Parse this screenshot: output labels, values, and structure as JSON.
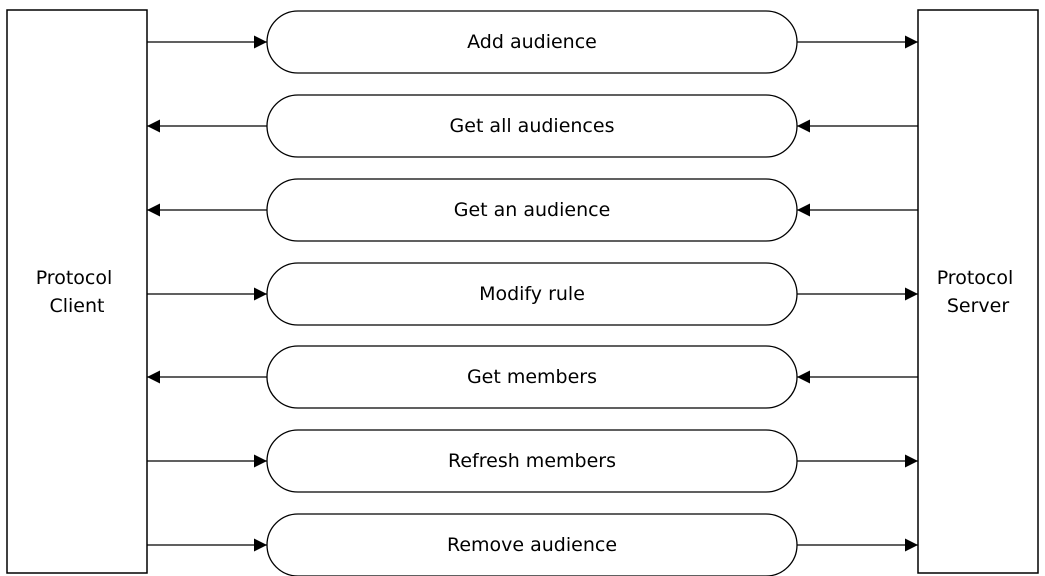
{
  "client": {
    "line1": "Protocol",
    "line2": "Client"
  },
  "server": {
    "line1": "Protocol",
    "line2": "Server"
  },
  "operations": [
    {
      "label": "Add audience",
      "direction": "client-to-server"
    },
    {
      "label": "Get all audiences",
      "direction": "server-to-client"
    },
    {
      "label": "Get an audience",
      "direction": "server-to-client"
    },
    {
      "label": "Modify rule",
      "direction": "client-to-server"
    },
    {
      "label": "Get members",
      "direction": "server-to-client"
    },
    {
      "label": "Refresh members",
      "direction": "client-to-server"
    },
    {
      "label": "Remove audience",
      "direction": "client-to-server"
    }
  ]
}
